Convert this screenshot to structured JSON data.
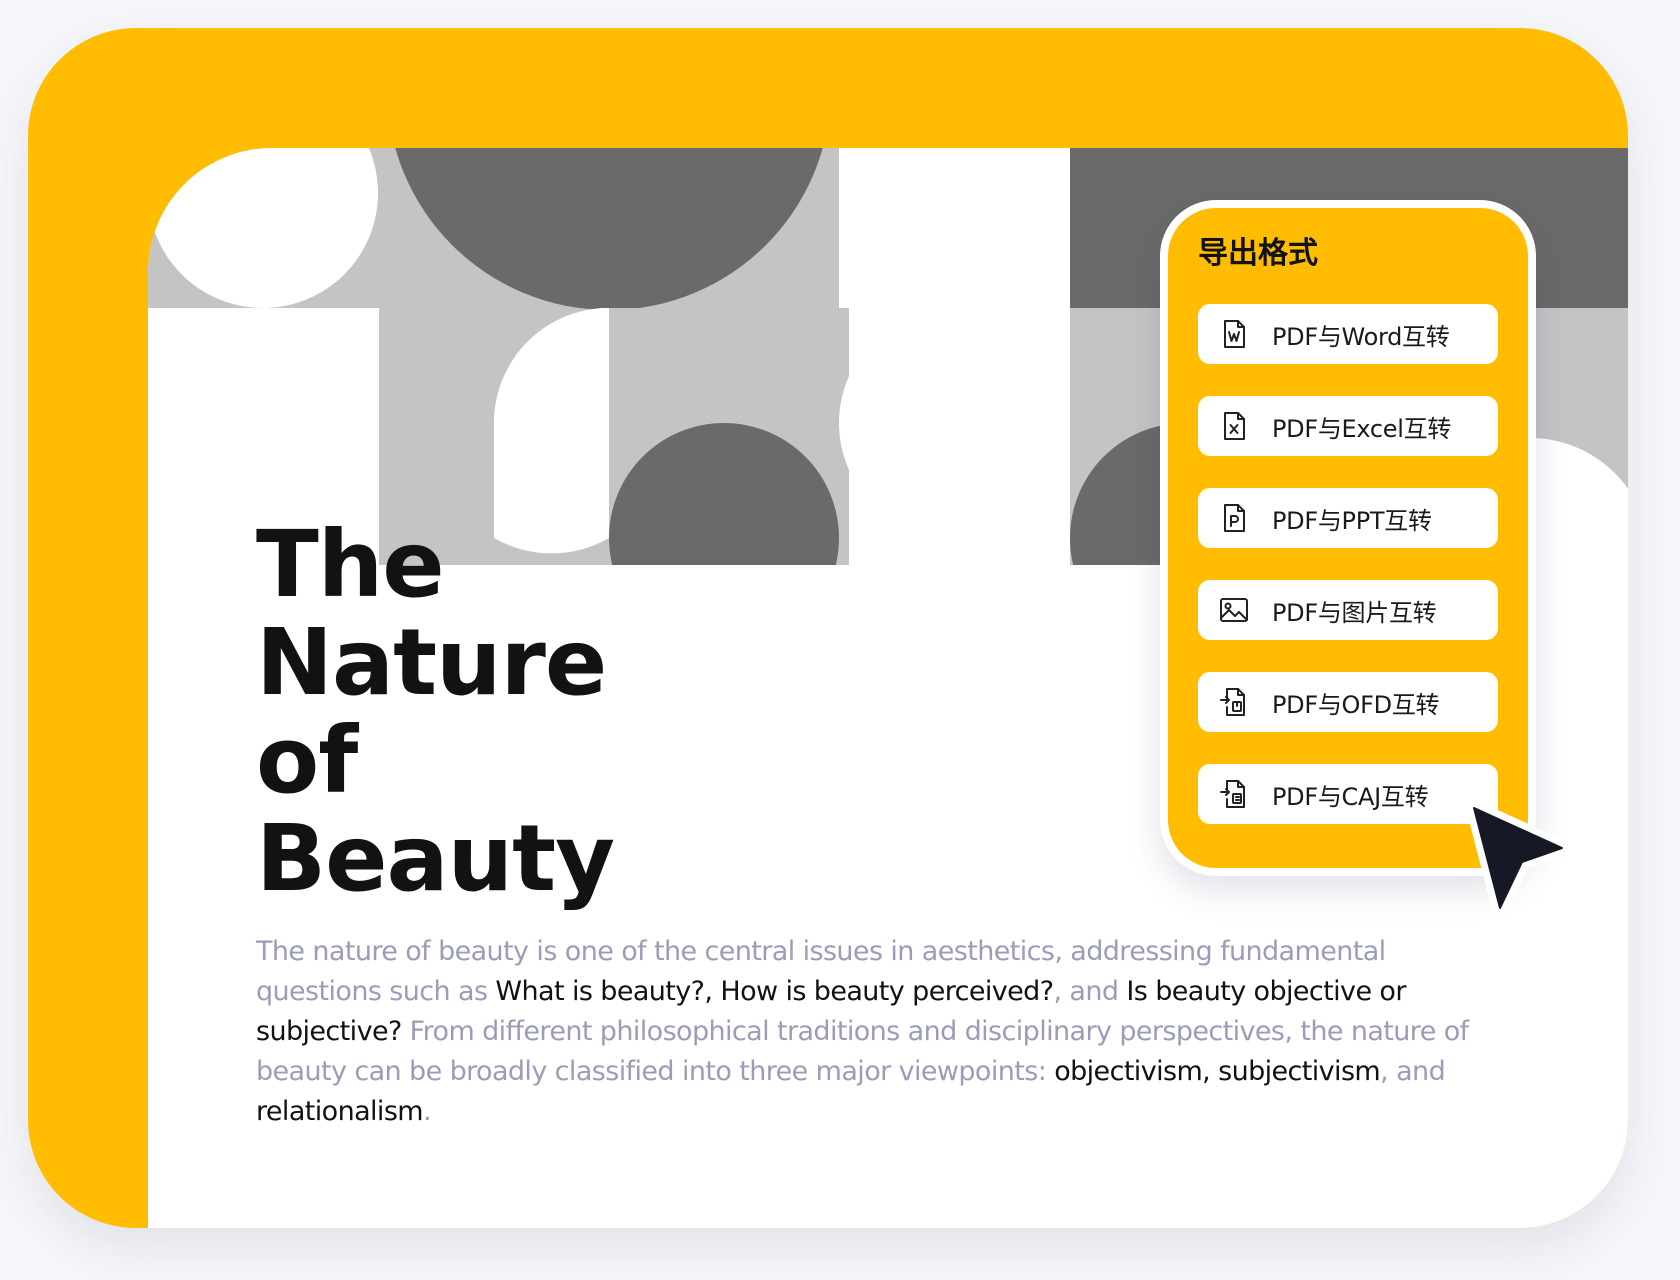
{
  "colors": {
    "accent": "#ffbc00",
    "card": "#ffffff",
    "pattern_light": "#c4c4c4",
    "pattern_dark": "#6a6a6a",
    "muted_text": "#9b9db8",
    "dark_text": "#121212"
  },
  "hero": {
    "title_lines": [
      "The",
      "Nature",
      "of",
      "Beauty"
    ],
    "body": {
      "s1": "The nature of beauty is one of the central issues in aesthetics, addressing fundamental questions such as ",
      "s2": "What is beauty?, How is beauty perceived?",
      "s3": ", and ",
      "s4": "Is beauty objective or subjective?",
      "s5": " From different philosophical traditions and disciplinary perspectives, the nature of beauty can be broadly classified into three major viewpoints: ",
      "s6": "objectivism, subjectivism",
      "s7": ", and ",
      "s8": "relationalism",
      "s9": "."
    }
  },
  "export_panel": {
    "title": "导出格式",
    "options": [
      {
        "label": "PDF与Word互转",
        "icon": "word-file-icon"
      },
      {
        "label": "PDF与Excel互转",
        "icon": "excel-file-icon"
      },
      {
        "label": "PDF与PPT互转",
        "icon": "ppt-file-icon"
      },
      {
        "label": "PDF与图片互转",
        "icon": "image-icon"
      },
      {
        "label": "PDF与OFD互转",
        "icon": "ofd-file-icon"
      },
      {
        "label": "PDF与CAJ互转",
        "icon": "caj-file-icon"
      }
    ]
  },
  "pointer": {
    "icon": "mouse-pointer-icon"
  }
}
